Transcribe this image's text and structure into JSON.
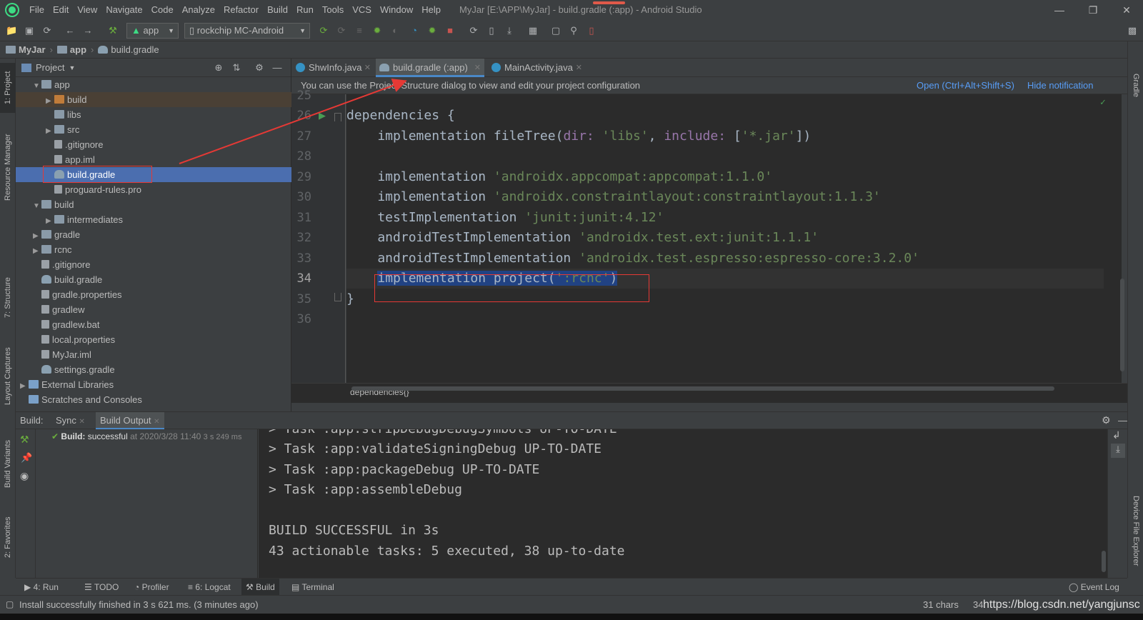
{
  "menu": {
    "items": [
      "File",
      "Edit",
      "View",
      "Navigate",
      "Code",
      "Analyze",
      "Refactor",
      "Build",
      "Run",
      "Tools",
      "VCS",
      "Window",
      "Help"
    ],
    "window_title": "MyJar [E:\\APP\\MyJar] - build.gradle (:app) - Android Studio"
  },
  "toolbar": {
    "run_config": "app",
    "device": "rockchip MC-Android"
  },
  "breadcrumb": [
    "MyJar",
    "app",
    "build.gradle"
  ],
  "project": {
    "header": "Project",
    "tree": [
      {
        "label": "app",
        "indent": 1,
        "expanded": true,
        "icon": "folder"
      },
      {
        "label": "build",
        "indent": 2,
        "expanded": false,
        "icon": "folder-orange"
      },
      {
        "label": "libs",
        "indent": 2,
        "icon": "folder"
      },
      {
        "label": "src",
        "indent": 2,
        "expanded": false,
        "icon": "folder"
      },
      {
        "label": ".gitignore",
        "indent": 2,
        "icon": "file"
      },
      {
        "label": "app.iml",
        "indent": 2,
        "icon": "file"
      },
      {
        "label": "build.gradle",
        "indent": 2,
        "icon": "gradle",
        "selected": true
      },
      {
        "label": "proguard-rules.pro",
        "indent": 2,
        "icon": "file"
      },
      {
        "label": "build",
        "indent": 1,
        "expanded": true,
        "icon": "folder"
      },
      {
        "label": "intermediates",
        "indent": 2,
        "expanded": false,
        "icon": "folder"
      },
      {
        "label": "gradle",
        "indent": 1,
        "expanded": false,
        "icon": "folder"
      },
      {
        "label": "rcnc",
        "indent": 1,
        "expanded": false,
        "icon": "folder"
      },
      {
        "label": ".gitignore",
        "indent": 1,
        "icon": "file"
      },
      {
        "label": "build.gradle",
        "indent": 1,
        "icon": "gradle"
      },
      {
        "label": "gradle.properties",
        "indent": 1,
        "icon": "file"
      },
      {
        "label": "gradlew",
        "indent": 1,
        "icon": "file"
      },
      {
        "label": "gradlew.bat",
        "indent": 1,
        "icon": "file"
      },
      {
        "label": "local.properties",
        "indent": 1,
        "icon": "file"
      },
      {
        "label": "MyJar.iml",
        "indent": 1,
        "icon": "file"
      },
      {
        "label": "settings.gradle",
        "indent": 1,
        "icon": "gradle"
      },
      {
        "label": "External Libraries",
        "indent": 0,
        "expanded": false,
        "icon": "lib"
      },
      {
        "label": "Scratches and Consoles",
        "indent": 0,
        "icon": "lib"
      }
    ]
  },
  "editor": {
    "tabs": [
      {
        "label": "ShwInfo.java",
        "icon": "java-class-icon"
      },
      {
        "label": "build.gradle (:app)",
        "icon": "gradle-icon",
        "active": true
      },
      {
        "label": "MainActivity.java",
        "icon": "java-class-icon"
      }
    ],
    "notification": {
      "message": "You can use the Project Structure dialog to view and edit your project configuration",
      "open_link": "Open (Ctrl+Alt+Shift+S)",
      "hide_link": "Hide notification"
    },
    "line_numbers": [
      "25",
      "26",
      "27",
      "28",
      "29",
      "30",
      "31",
      "32",
      "33",
      "34",
      "35",
      "36"
    ],
    "current_line": "34",
    "code": {
      "l26": "dependencies {",
      "l27_a": "    implementation fileTree(",
      "l27_b": "dir:",
      "l27_c": " 'libs'",
      "l27_d": ", ",
      "l27_e": "include:",
      "l27_f": " [",
      "l27_g": "'*.jar'",
      "l27_h": "])",
      "l29_a": "    implementation ",
      "l29_b": "'androidx.appcompat:appcompat:1.1.0'",
      "l30_a": "    implementation ",
      "l30_b": "'androidx.constraintlayout:constraintlayout:1.1.3'",
      "l31_a": "    testImplementation ",
      "l31_b": "'junit:junit:4.12'",
      "l32_a": "    androidTestImplementation ",
      "l32_b": "'androidx.test.ext:junit:1.1.1'",
      "l33_a": "    androidTestImplementation ",
      "l33_b": "'androidx.test.espresso:espresso-core:3.2.0'",
      "l34_indent": "    ",
      "l34_a": "implementation project(",
      "l34_b": "':rcnc'",
      "l34_c": ")",
      "l35": "}"
    },
    "footer_breadcrumb": "dependencies{}"
  },
  "build_panel": {
    "label": "Build:",
    "tabs": [
      "Sync",
      "Build Output"
    ],
    "active_tab": "Build Output",
    "tree_status": "Build:",
    "tree_result": "successful",
    "tree_time": "at 2020/3/28 11:40",
    "tree_duration": "3 s 249 ms",
    "output_lines": [
      "> Task :app:stripDebugDebugSymbols UP-TO-DATE",
      "> Task :app:validateSigningDebug UP-TO-DATE",
      "> Task :app:packageDebug UP-TO-DATE",
      "> Task :app:assembleDebug",
      "",
      "BUILD SUCCESSFUL in 3s",
      "43 actionable tasks: 5 executed, 38 up-to-date"
    ]
  },
  "bottom_tabs": [
    {
      "label": "4: Run",
      "icon": "run-icon"
    },
    {
      "label": "TODO",
      "icon": "todo-icon"
    },
    {
      "label": "Profiler",
      "icon": "profiler-icon"
    },
    {
      "label": "6: Logcat",
      "icon": "logcat-icon"
    },
    {
      "label": "Build",
      "icon": "build-hammer-icon",
      "active": true
    },
    {
      "label": "Terminal",
      "icon": "terminal-icon"
    }
  ],
  "event_log": "Event Log",
  "side_tabs": {
    "left": [
      "1: Project",
      "Resource Manager",
      "7: Structure",
      "Layout Captures",
      "Build Variants",
      "2: Favorites"
    ],
    "right": [
      "Gradle",
      "Device File Explorer"
    ]
  },
  "status": {
    "message": "Install successfully finished in 3 s 621 ms. (3 minutes ago)",
    "chars": "31 chars",
    "position": "34:",
    "watermark": "https://blog.csdn.net/yangjunsc"
  },
  "colors": {
    "accent": "#4a88c7",
    "selection": "#4b6eaf",
    "annotation_red": "#e53935",
    "string_green": "#6a8759",
    "param_purple": "#9876aa"
  }
}
